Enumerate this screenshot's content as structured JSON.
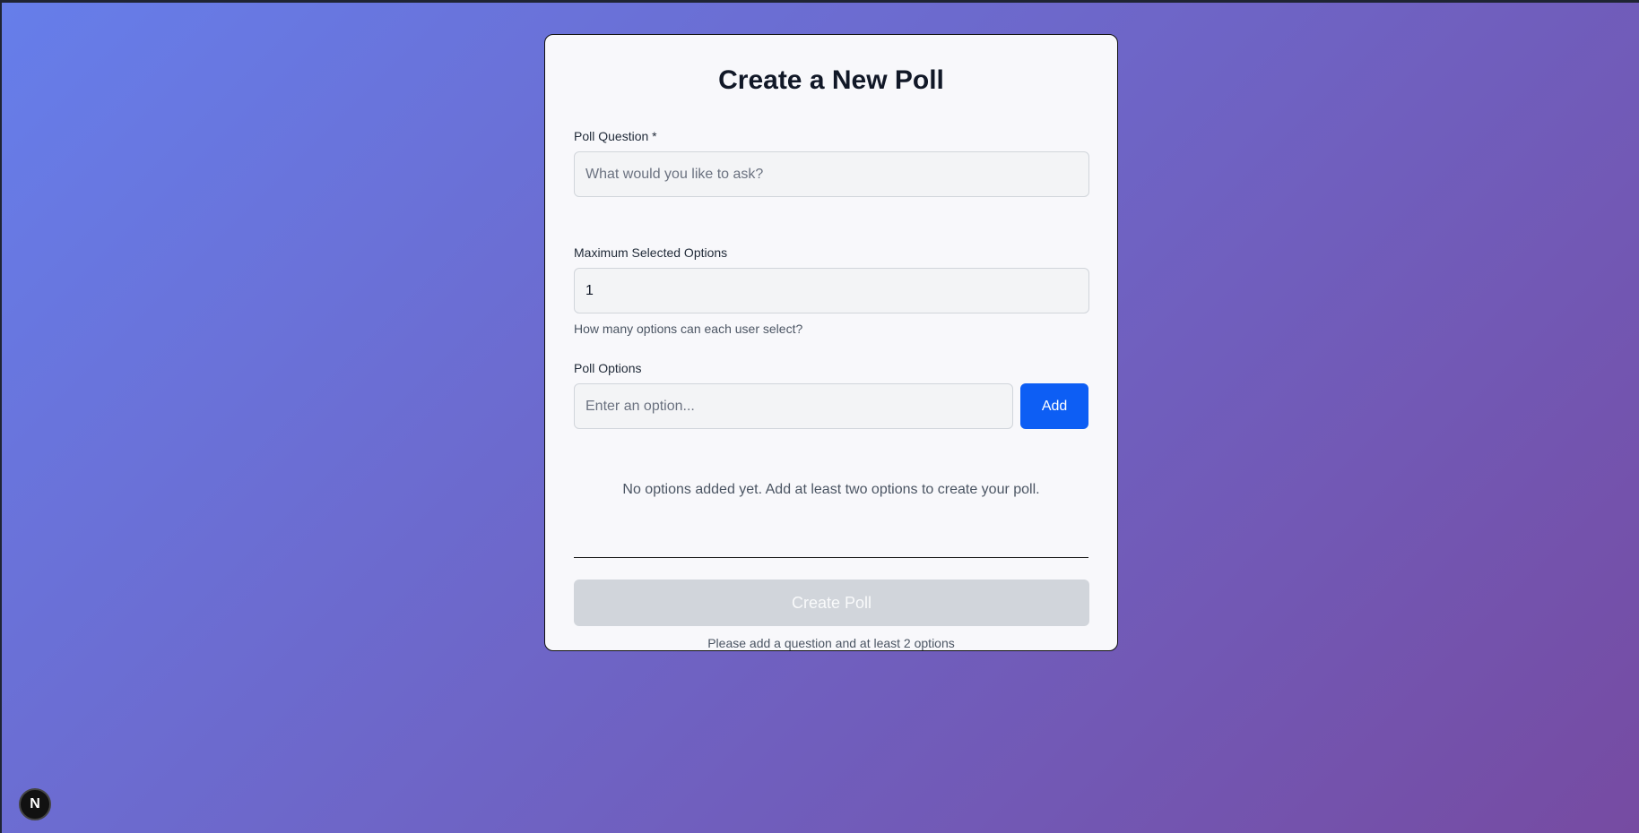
{
  "page": {
    "title": "Create a New Poll",
    "accent_color": "#0d5ef4",
    "background_gradient": [
      "#667eea",
      "#764ba2"
    ]
  },
  "question": {
    "label": "Poll Question *",
    "placeholder": "What would you like to ask?",
    "value": ""
  },
  "max_options": {
    "label": "Maximum Selected Options",
    "value": "1",
    "hint": "How many options can each user select?"
  },
  "options": {
    "label": "Poll Options",
    "placeholder": "Enter an option...",
    "add_label": "Add",
    "empty_message": "No options added yet. Add at least two options to create your poll.",
    "items": []
  },
  "submit": {
    "label": "Create Poll",
    "disabled": true,
    "note": "Please add a question and at least 2 options"
  },
  "dev_badge": {
    "label": "N",
    "icon": "nextjs-logo-icon"
  }
}
